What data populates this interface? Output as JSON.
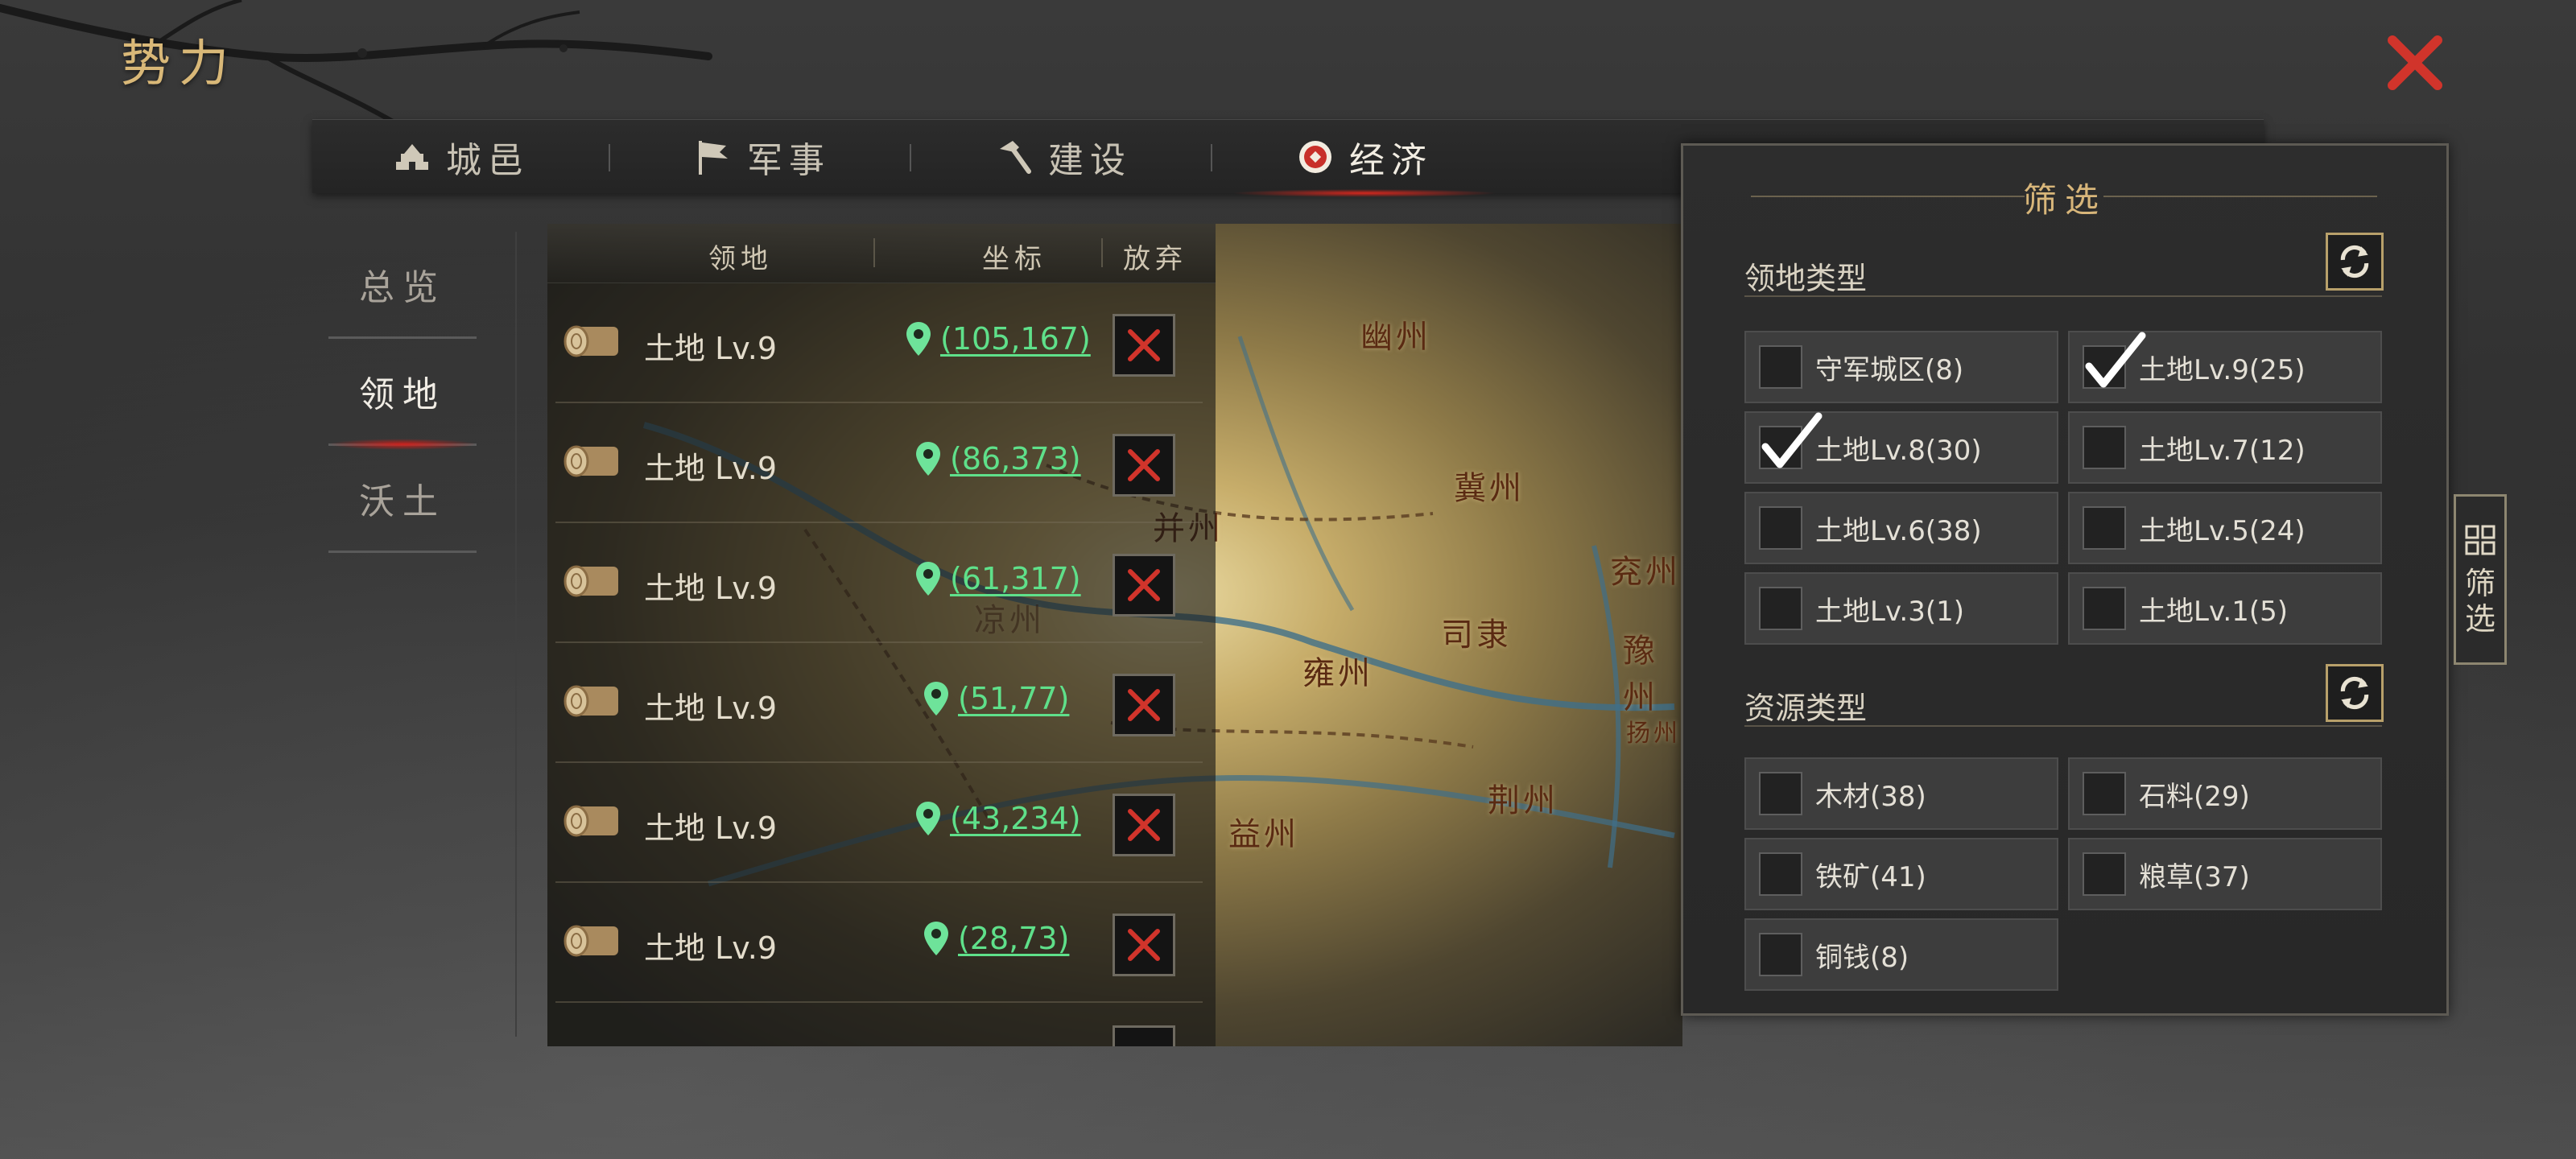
{
  "page": {
    "title": "势力"
  },
  "tabs": [
    {
      "label": "城邑",
      "icon": "castle-icon",
      "active": false
    },
    {
      "label": "军事",
      "icon": "flag-icon",
      "active": false
    },
    {
      "label": "建设",
      "icon": "hammer-icon",
      "active": false
    },
    {
      "label": "经济",
      "icon": "coin-icon",
      "active": true
    }
  ],
  "side_menu": [
    {
      "label": "总览",
      "active": false
    },
    {
      "label": "领地",
      "active": true
    },
    {
      "label": "沃土",
      "active": false
    }
  ],
  "table": {
    "headers": {
      "territory": "领地",
      "coords": "坐标",
      "abandon": "放弃"
    },
    "rows": [
      {
        "name": "土地 Lv.9",
        "coords": "(105,167)",
        "icon": "wood-log-icon"
      },
      {
        "name": "土地 Lv.9",
        "coords": "(86,373)",
        "icon": "wood-log-icon"
      },
      {
        "name": "土地 Lv.9",
        "coords": "(61,317)",
        "icon": "wood-log-icon"
      },
      {
        "name": "土地 Lv.9",
        "coords": "(51,77)",
        "icon": "wood-log-icon"
      },
      {
        "name": "土地 Lv.9",
        "coords": "(43,234)",
        "icon": "wood-log-icon"
      },
      {
        "name": "土地 Lv.9",
        "coords": "(28,73)",
        "icon": "wood-log-icon"
      }
    ]
  },
  "map": {
    "regions": [
      "幽州",
      "冀州",
      "并州",
      "兖州",
      "雍州",
      "司隶",
      "豫州",
      "荆州",
      "益州",
      "扬州",
      "凉州"
    ]
  },
  "filter": {
    "title": "筛选",
    "territory_type": {
      "title": "领地类型",
      "options": [
        {
          "label": "守军城区(8)",
          "checked": false
        },
        {
          "label": "土地Lv.9(25)",
          "checked": true
        },
        {
          "label": "土地Lv.8(30)",
          "checked": true
        },
        {
          "label": "土地Lv.7(12)",
          "checked": false
        },
        {
          "label": "土地Lv.6(38)",
          "checked": false
        },
        {
          "label": "土地Lv.5(24)",
          "checked": false
        },
        {
          "label": "土地Lv.3(1)",
          "checked": false
        },
        {
          "label": "土地Lv.1(5)",
          "checked": false
        }
      ]
    },
    "resource_type": {
      "title": "资源类型",
      "options": [
        {
          "label": "木材(38)",
          "checked": false
        },
        {
          "label": "石料(29)",
          "checked": false
        },
        {
          "label": "铁矿(41)",
          "checked": false
        },
        {
          "label": "粮草(37)",
          "checked": false
        },
        {
          "label": "铜钱(8)",
          "checked": false
        }
      ]
    },
    "side_tab_label": "筛选"
  },
  "colors": {
    "accent_red": "#d1342b",
    "coord_green": "#5fe08a",
    "title_gold": "#d9b878"
  }
}
